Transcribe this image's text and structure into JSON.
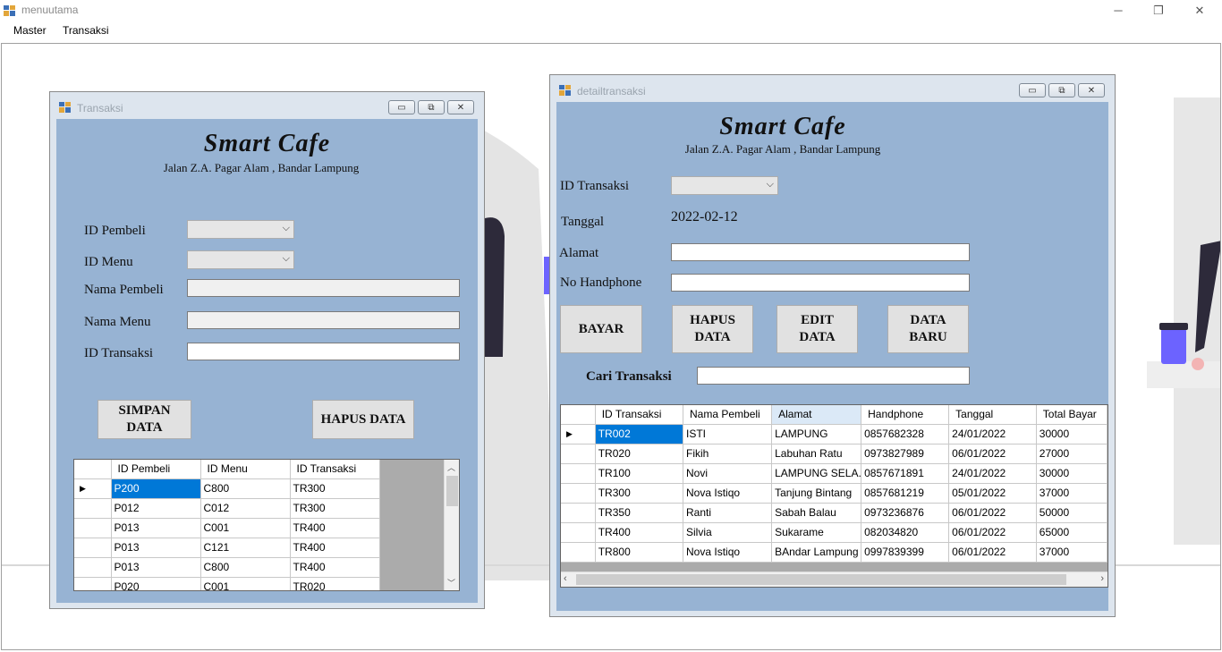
{
  "app": {
    "title": "menuutama"
  },
  "window_controls": {
    "minimize": "─",
    "restore": "❐",
    "close": "✕"
  },
  "menubar": [
    "Master",
    "Transaksi"
  ],
  "transaksi_window": {
    "title": "Transaksi",
    "brand": "Smart Cafe",
    "address": "Jalan Z.A. Pagar Alam , Bandar Lampung",
    "labels": {
      "id_pembeli": "ID Pembeli",
      "id_menu": "ID Menu",
      "nama_pembeli": "Nama Pembeli",
      "nama_menu": "Nama Menu",
      "id_transaksi": "ID Transaksi"
    },
    "values": {
      "id_pembeli": "",
      "id_menu": "",
      "nama_pembeli": "",
      "nama_menu": "",
      "id_transaksi": ""
    },
    "buttons": {
      "simpan": "SIMPAN DATA",
      "hapus": "HAPUS DATA"
    },
    "grid": {
      "columns": [
        "ID Pembeli",
        "ID Menu",
        "ID Transaksi"
      ],
      "rows": [
        [
          "P200",
          "C800",
          "TR300"
        ],
        [
          "P012",
          "C012",
          "TR300"
        ],
        [
          "P013",
          "C001",
          "TR400"
        ],
        [
          "P013",
          "C121",
          "TR400"
        ],
        [
          "P013",
          "C800",
          "TR400"
        ],
        [
          "P020",
          "C001",
          "TR020"
        ]
      ],
      "current_row_marker": "▶"
    }
  },
  "detail_window": {
    "title": "detailtransaksi",
    "brand": "Smart Cafe",
    "address": "Jalan Z.A. Pagar Alam , Bandar Lampung",
    "labels": {
      "id_transaksi": "ID Transaksi",
      "tanggal": "Tanggal",
      "alamat": "Alamat",
      "no_handphone": "No Handphone",
      "cari": "Cari Transaksi"
    },
    "values": {
      "tanggal": "2022-02-12",
      "alamat": "",
      "no_handphone": "",
      "cari": ""
    },
    "buttons": {
      "bayar": "BAYAR",
      "hapus": "HAPUS DATA",
      "edit": "EDIT DATA",
      "baru": "DATA BARU"
    },
    "grid": {
      "columns": [
        "ID Transaksi",
        "Nama Pembeli",
        "Alamat",
        "Handphone",
        "Tanggal",
        "Total Bayar"
      ],
      "rows": [
        [
          "TR002",
          "ISTI",
          "LAMPUNG",
          "0857682328",
          "24/01/2022",
          "30000"
        ],
        [
          "TR020",
          "Fikih",
          "Labuhan Ratu",
          "0973827989",
          "06/01/2022",
          "27000"
        ],
        [
          "TR100",
          "Novi",
          "LAMPUNG SELA...",
          "0857671891",
          "24/01/2022",
          "30000"
        ],
        [
          "TR300",
          "Nova Istiqo",
          "Tanjung Bintang",
          "0857681219",
          "05/01/2022",
          "37000"
        ],
        [
          "TR350",
          "Ranti",
          "Sabah Balau",
          "0973236876",
          "06/01/2022",
          "50000"
        ],
        [
          "TR400",
          "Silvia",
          "Sukarame",
          "082034820",
          "06/01/2022",
          "65000"
        ],
        [
          "TR800",
          "Nova Istiqo",
          "BAndar Lampung",
          "0997839399",
          "06/01/2022",
          "37000"
        ]
      ],
      "current_row_marker": "▶"
    }
  }
}
